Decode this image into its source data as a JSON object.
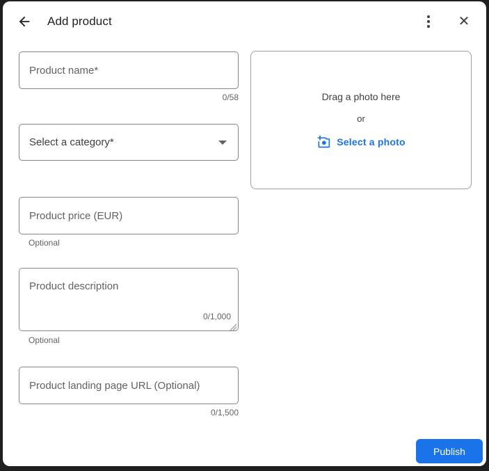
{
  "header": {
    "title": "Add product",
    "back_icon": "arrow-back",
    "menu_icon": "kebab-menu",
    "close_icon": "close",
    "close_glyph": "✕"
  },
  "form": {
    "product_name": {
      "placeholder": "Product name*",
      "counter": "0/58"
    },
    "category": {
      "value": "Select a category*",
      "dropdown_icon": "chevron-down"
    },
    "price": {
      "placeholder": "Product price (EUR)",
      "helper": "Optional"
    },
    "description": {
      "placeholder": "Product description",
      "counter": "0/1,000",
      "helper": "Optional",
      "resize_icon": "resize-grip"
    },
    "landing_url": {
      "placeholder": "Product landing page URL (Optional)",
      "counter": "0/1,500"
    }
  },
  "photo_upload": {
    "drag_label": "Drag a photo here",
    "or_label": "or",
    "select_label": "Select a photo",
    "camera_icon": "add-a-photo"
  },
  "footer": {
    "publish_label": "Publish"
  },
  "colors": {
    "accent_blue": "#1a73e8",
    "text_primary": "#202124",
    "text_secondary": "#3c4043",
    "text_muted": "#5f6368",
    "input_border": "#80868b",
    "backdrop": "#1f1f1f"
  }
}
